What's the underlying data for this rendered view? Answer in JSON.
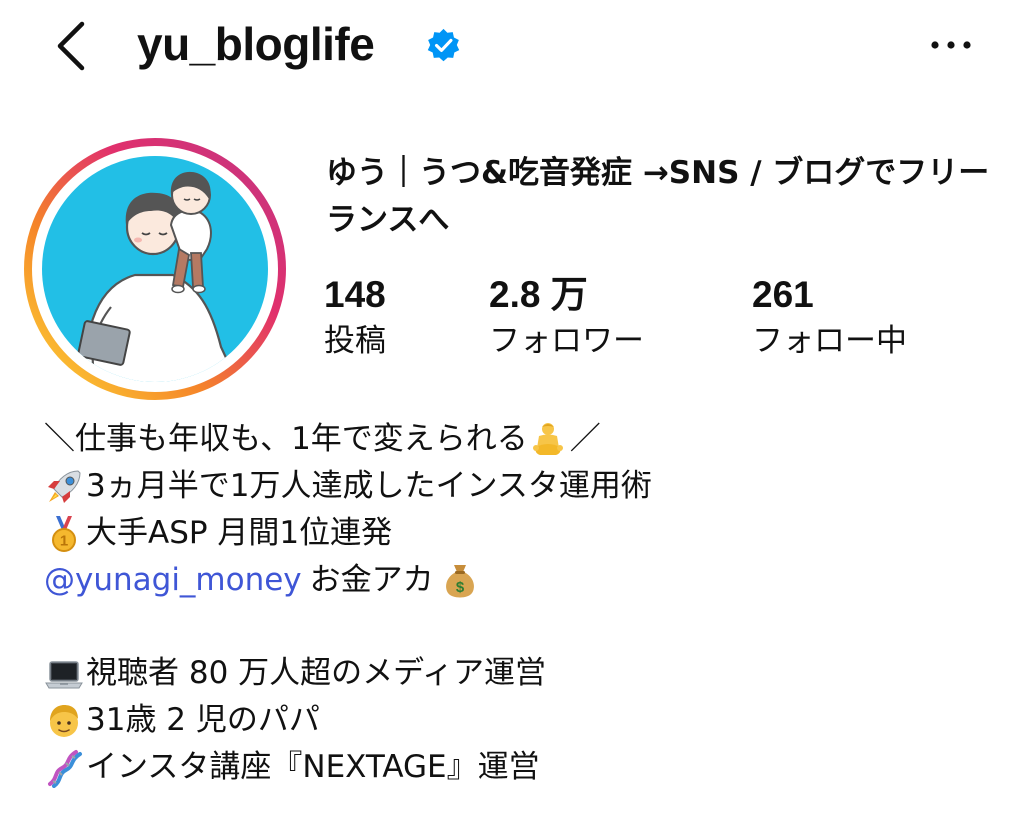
{
  "header": {
    "username": "yu_bloglife",
    "back_icon": "chevron-left-icon",
    "verified_icon": "verified-badge-icon",
    "more_icon": "more-horizontal-icon"
  },
  "profile": {
    "display_name": "ゆう｜うつ&吃音発症 →SNS / ブログでフリーランスへ"
  },
  "stats": {
    "posts": {
      "value": "148",
      "label": "投稿"
    },
    "followers": {
      "value": "2.8 万",
      "label": "フォロワー"
    },
    "following": {
      "value": "261",
      "label": "フォロー中"
    }
  },
  "bio": {
    "line1": {
      "pre": "＼仕事も年収も、1年で変えられる",
      "emoji": "person-in-lotus-position-emoji",
      "post": "／"
    },
    "line2": {
      "emoji": "rocket-emoji",
      "text": "3ヵ月半で1万人達成したインスタ運用術"
    },
    "line3": {
      "emoji": "medal-emoji",
      "text": "大手ASP 月間1位連発"
    },
    "line4": {
      "mention": "@yunagi_money",
      "text": "お金アカ",
      "emoji": "money-bag-emoji"
    },
    "line5": {
      "emoji": "laptop-emoji",
      "text": "視聴者 80 万人超のメディア運営"
    },
    "line6": {
      "emoji": "man-emoji",
      "text": "31歳 2 児のパパ"
    },
    "line7": {
      "emoji": "dna-emoji",
      "text": "インスタ講座『NEXTAGE』運営"
    }
  },
  "colors": {
    "text": "#111111",
    "mention": "#3f56d6",
    "verified": "#0095f6",
    "avatar_bg": "#22bfe6",
    "story_ring_start": "#fdd835",
    "story_ring_end": "#e1306c"
  }
}
